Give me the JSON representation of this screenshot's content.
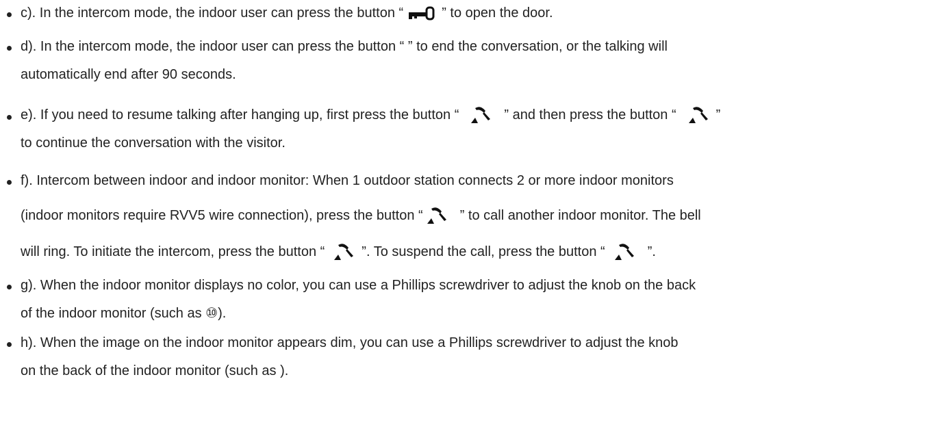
{
  "items": [
    {
      "id": "c",
      "line1_a": "c). In the intercom mode, the indoor user can press the button “",
      "line1_icon": "key-icon",
      "line1_b": "” to open the door."
    },
    {
      "id": "d",
      "line1": "d). In the intercom mode, the indoor user can press the button “ ” to end the conversation, or the talking will",
      "line2": "automatically end after 90 seconds."
    },
    {
      "id": "e",
      "line1_a": "e). If you need to resume talking after hanging up, first press the button “",
      "line1_b": "” and then press the button “",
      "line1_c": "”",
      "line1_icons": [
        "handset-icon",
        "handset-icon"
      ],
      "line2": "to continue the conversation with the visitor."
    },
    {
      "id": "f",
      "line1": "f). Intercom between indoor and indoor monitor: When 1 outdoor station connects 2 or more indoor monitors",
      "line2_a": "(indoor monitors require RVV5 wire connection), press the button “",
      "line2_b": "” to call another indoor monitor. The bell",
      "line3_a": "will ring. To initiate the intercom, press the button “",
      "line3_b": "”. To suspend the call, press the button “",
      "line3_c": "”.",
      "icons": [
        "handset-icon",
        "handset-icon",
        "handset-icon"
      ]
    },
    {
      "id": "g",
      "line1": "g). When the indoor monitor displays no color, you can use a Phillips screwdriver to adjust the knob on the back",
      "line2": "of the indoor monitor (such as ⑩)."
    },
    {
      "id": "h",
      "line1": "h). When the image on the indoor monitor appears dim, you can use a Phillips screwdriver to adjust the knob",
      "line2": "on the back of the indoor monitor (such as  )."
    }
  ]
}
